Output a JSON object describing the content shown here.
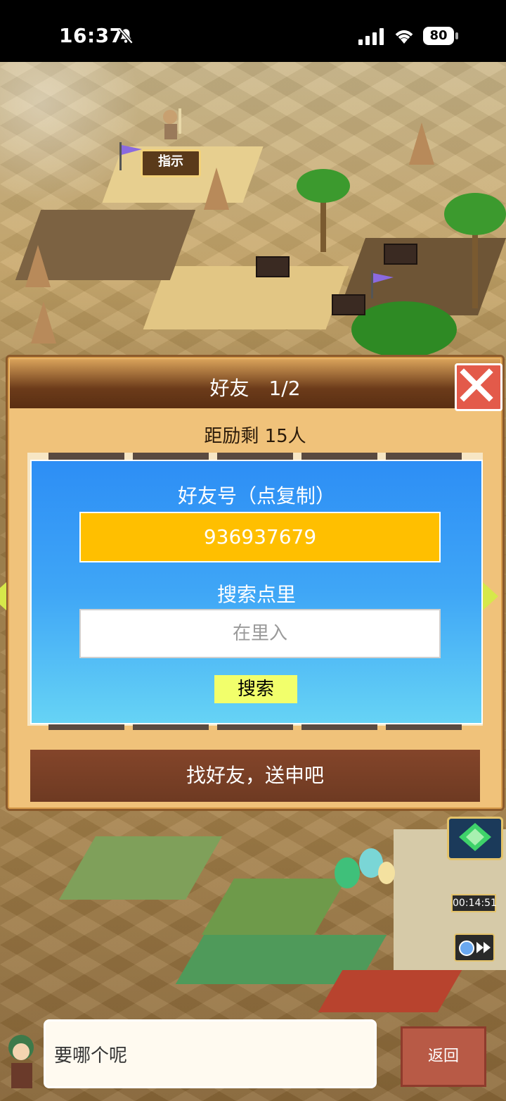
{
  "status_bar": {
    "time": "16:37",
    "battery": "80"
  },
  "map": {
    "hint_label": "指示"
  },
  "dialog": {
    "title": "好友　1/2",
    "subtitle": "距励剩 15人",
    "friend_id_label": "好友号（点复制）",
    "friend_id_value": "936937679",
    "search_label": "搜索点里",
    "search_placeholder": "在里入",
    "search_button": "搜索",
    "find_button": "找好友，送申吧"
  },
  "bottom": {
    "message": "要哪个呢",
    "back_button": "返回",
    "timer_text": "00:14:51"
  },
  "colors": {
    "accent_blue": "#2d8ef5",
    "id_yellow": "#ffbf00",
    "search_btn": "#f2ff6b",
    "close_red": "#e35a4a",
    "header_brown": "#6c3b1a"
  }
}
